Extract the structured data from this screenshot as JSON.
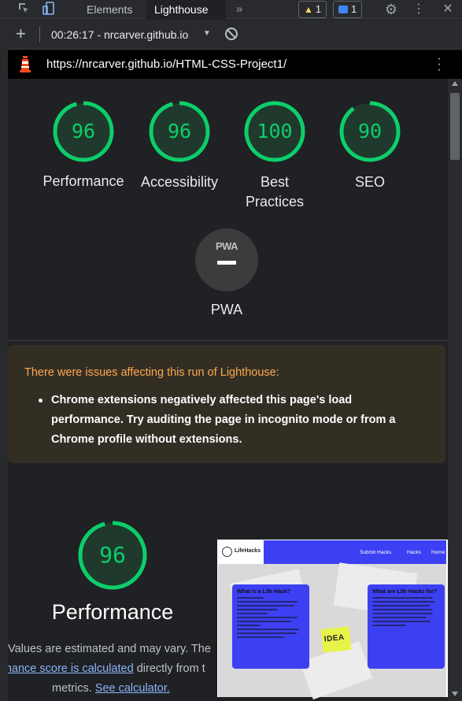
{
  "devtools": {
    "tabs": [
      "Elements",
      "Lighthouse"
    ],
    "more_tabs_icon": "double-chevron-right-icon",
    "warnings_count": "1",
    "messages_count": "1"
  },
  "report_toolbar": {
    "selected_report": "00:26:17 - nrcarver.github.io",
    "add_icon": "plus-icon",
    "clear_icon": "block-icon"
  },
  "url_bar": {
    "url": "https://nrcarver.github.io/HTML-CSS-Project1/"
  },
  "scores": [
    {
      "value": "96",
      "label": "Performance",
      "color": "#0cce6b"
    },
    {
      "value": "96",
      "label": "Accessibility",
      "color": "#0cce6b"
    },
    {
      "value": "100",
      "label": "Best Practices",
      "color": "#0cce6b"
    },
    {
      "value": "90",
      "label": "SEO",
      "color": "#0cce6b"
    }
  ],
  "pwa": {
    "badge_text": "PWA",
    "label": "PWA"
  },
  "warning": {
    "title": "There were issues affecting this run of Lighthouse:",
    "item": "Chrome extensions negatively affected this page's load performance. Try auditing the page in incognito mode or from a Chrome profile without extensions.",
    "title_color": "#ffa94d"
  },
  "performance_section": {
    "score": "96",
    "title": "Performance",
    "desc_line1": "Values are estimated and may vary. The",
    "desc_link1": "rmance score is calculated",
    "desc_line2_rest": " directly from t",
    "desc_line3": "metrics.",
    "desc_link2": "See calculator."
  },
  "thumbnail": {
    "logo_text": "LifeHacks",
    "nav": [
      "Submit Hacks",
      "Hacks",
      "Home"
    ],
    "card_left_title": "What is a Life Hack?",
    "card_right_title": "What are Life Hacks for?",
    "sticky_text": "IDEA",
    "brand_color": "#3d40f2"
  }
}
